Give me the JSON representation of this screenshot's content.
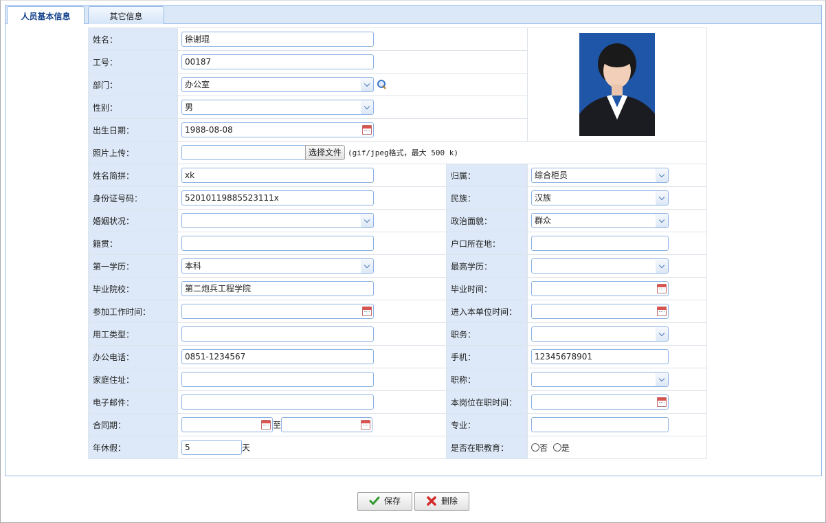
{
  "tabs": [
    {
      "label": "人员基本信息",
      "active": true
    },
    {
      "label": "其它信息",
      "active": false
    }
  ],
  "fields": {
    "name": {
      "label": "姓名：",
      "value": "徐谢琨"
    },
    "emp_no": {
      "label": "工号：",
      "value": "00187"
    },
    "dept": {
      "label": "部门：",
      "value": "办公室"
    },
    "gender": {
      "label": "性别：",
      "value": "男"
    },
    "birth": {
      "label": "出生日期：",
      "value": "1988-08-08"
    },
    "photo_upload": {
      "label": "照片上传：",
      "button": "选择文件",
      "hint": "(gif/jpeg格式，最大 500 k)"
    },
    "pinyin": {
      "label": "姓名简拼：",
      "value": "xk"
    },
    "belong": {
      "label": "归属：",
      "value": "综合柜员"
    },
    "idcard": {
      "label": "身份证号码：",
      "value": "52010119885523111x"
    },
    "nation": {
      "label": "民族：",
      "value": "汉族"
    },
    "marriage": {
      "label": "婚姻状况：",
      "value": ""
    },
    "politics": {
      "label": "政治面貌：",
      "value": "群众"
    },
    "native": {
      "label": "籍贯：",
      "value": ""
    },
    "hukou": {
      "label": "户口所在地：",
      "value": ""
    },
    "first_edu": {
      "label": "第一学历：",
      "value": "本科"
    },
    "top_edu": {
      "label": "最高学历：",
      "value": ""
    },
    "school": {
      "label": "毕业院校：",
      "value": "第二炮兵工程学院"
    },
    "grad_time": {
      "label": "毕业时间：",
      "value": ""
    },
    "work_time": {
      "label": "参加工作时间：",
      "value": ""
    },
    "join_time": {
      "label": "进入本单位时间：",
      "value": ""
    },
    "emp_type": {
      "label": "用工类型：",
      "value": ""
    },
    "duty": {
      "label": "职务：",
      "value": ""
    },
    "office_tel": {
      "label": "办公电话：",
      "value": "0851-1234567"
    },
    "mobile": {
      "label": "手机：",
      "value": "12345678901"
    },
    "address": {
      "label": "家庭住址：",
      "value": ""
    },
    "title": {
      "label": "职称：",
      "value": ""
    },
    "email": {
      "label": "电子邮件：",
      "value": ""
    },
    "post_time": {
      "label": "本岗位在职时间：",
      "value": ""
    },
    "contract": {
      "label": "合同期：",
      "from": "",
      "sep": "至",
      "to": ""
    },
    "major": {
      "label": "专业：",
      "value": ""
    },
    "annual_leave": {
      "label": "年休假：",
      "value": "5",
      "unit": "天"
    },
    "in_service_edu": {
      "label": "是否在职教育：",
      "opt_no": "否",
      "opt_yes": "是"
    }
  },
  "buttons": {
    "save": "保存",
    "delete": "删除"
  },
  "colors": {
    "label_bg": "#dde9f8",
    "border": "#99bbe8",
    "input_border": "#8db2e3",
    "photo_bg": "#1f56a8"
  }
}
